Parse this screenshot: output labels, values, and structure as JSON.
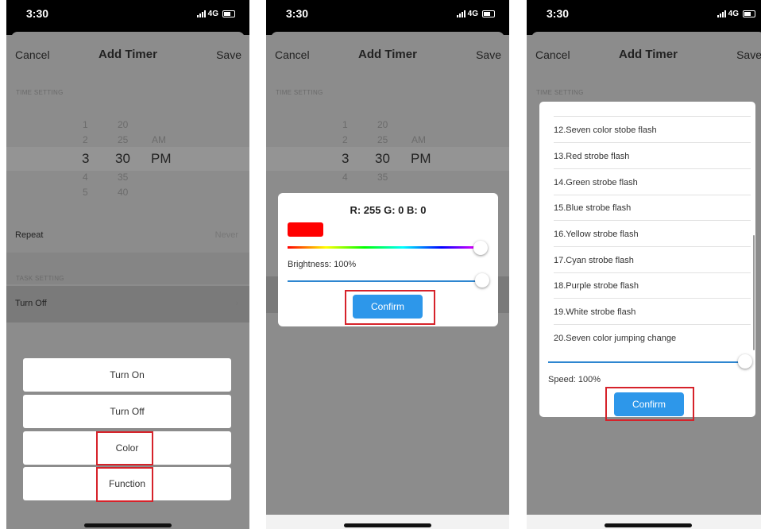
{
  "status": {
    "time": "3:30",
    "network": "4G"
  },
  "nav": {
    "cancel": "Cancel",
    "title": "Add Timer",
    "save": "Save"
  },
  "sections": {
    "time_setting": "TIME SETTING",
    "task_setting": "TASK SETTING"
  },
  "picker": {
    "hours": [
      "1",
      "2",
      "3",
      "4",
      "5"
    ],
    "minutes": [
      "20",
      "25",
      "30",
      "35",
      "40"
    ],
    "ampm": [
      "AM",
      "PM"
    ],
    "selected": {
      "hour": "3",
      "minute": "30",
      "ampm": "PM"
    }
  },
  "repeat": {
    "label": "Repeat",
    "value": "Never"
  },
  "task": {
    "label": "Turn Off"
  },
  "action_sheet": {
    "items": [
      "Turn On",
      "Turn Off",
      "Color",
      "Function"
    ]
  },
  "color_dialog": {
    "rgb_text": "R: 255 G: 0 B: 0",
    "swatch_color": "#ff0000",
    "brightness_label": "Brightness: 100%",
    "brightness": 1.0,
    "confirm": "Confirm"
  },
  "function_dialog": {
    "items": [
      "12.Seven color stobe flash",
      "13.Red strobe flash",
      "14.Green strobe flash",
      "15.Blue strobe flash",
      "16.Yellow strobe flash",
      "17.Cyan strobe flash",
      "18.Purple strobe flash",
      "19.White strobe flash",
      "20.Seven color jumping change"
    ],
    "speed_label": "Speed: 100%",
    "speed": 1.0,
    "confirm": "Confirm"
  },
  "colors": {
    "accent": "#2d97ea",
    "highlight": "#d6222a",
    "overlay": "#8c8c8c"
  }
}
